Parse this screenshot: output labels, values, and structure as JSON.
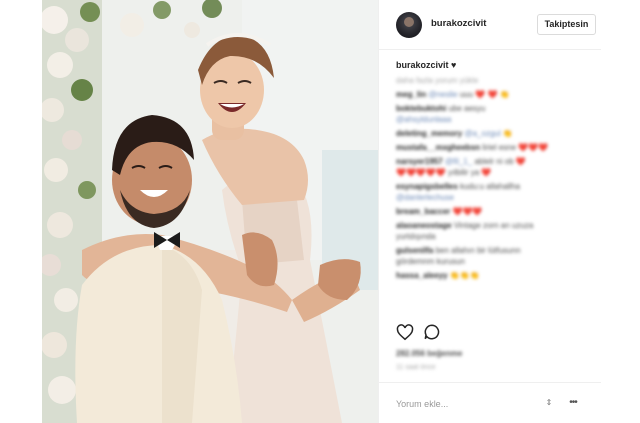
{
  "header": {
    "username": "burakozcivit",
    "follow_label": "Takiptesin"
  },
  "caption": {
    "username": "burakozcivit",
    "text": "♥"
  },
  "comments": {
    "view_all": "daha fazla yorum yükle",
    "items": [
      {
        "user": "meg_lin",
        "mention": "@neslie",
        "text": "uuu ❤️ ❤️ 👏"
      },
      {
        "user": "boktebuktohi",
        "text": "ube aesyu"
      },
      {
        "mention": "@ahsyldunlaaa"
      },
      {
        "user": "deleting_memory",
        "mention": "@a_ozgul",
        "text": "👏"
      },
      {
        "user": "mustafa__mxgheebsn",
        "text": "liriel esne ❤️❤️❤️"
      },
      {
        "user": "narsyer1957",
        "mention": "@fil_1_",
        "text": "ablelr ni ob ❤️"
      },
      {
        "text": "❤️❤️❤️❤️❤️ yılbilir ya ❤️"
      },
      {
        "user": "esynapigsbelles",
        "text": "kudu:u allahallha"
      },
      {
        "mention": "@danlerlechuse"
      },
      {
        "user": "bream_baccer",
        "text": "❤️❤️❤️"
      },
      {
        "user": "alaoaneostage",
        "text": "Vintage zorn an uzuza"
      },
      {
        "text": "yurtdışında"
      },
      {
        "user": "gulsenilfa",
        "text": "ben allahın bir lütfusunn"
      },
      {
        "text": "gördemnm kurusun"
      },
      {
        "user": "hassa_aleeyy",
        "text": "👏👏👏"
      }
    ]
  },
  "actions": {
    "like_icon": "heart-outline-icon",
    "comment_icon": "speech-bubble-icon",
    "likes": "282.056 beğenme",
    "time": "11 saat önce"
  },
  "add_comment": {
    "placeholder": "Yorum ekle...",
    "sort_symbol": "⇕",
    "more_symbol": "•••"
  }
}
